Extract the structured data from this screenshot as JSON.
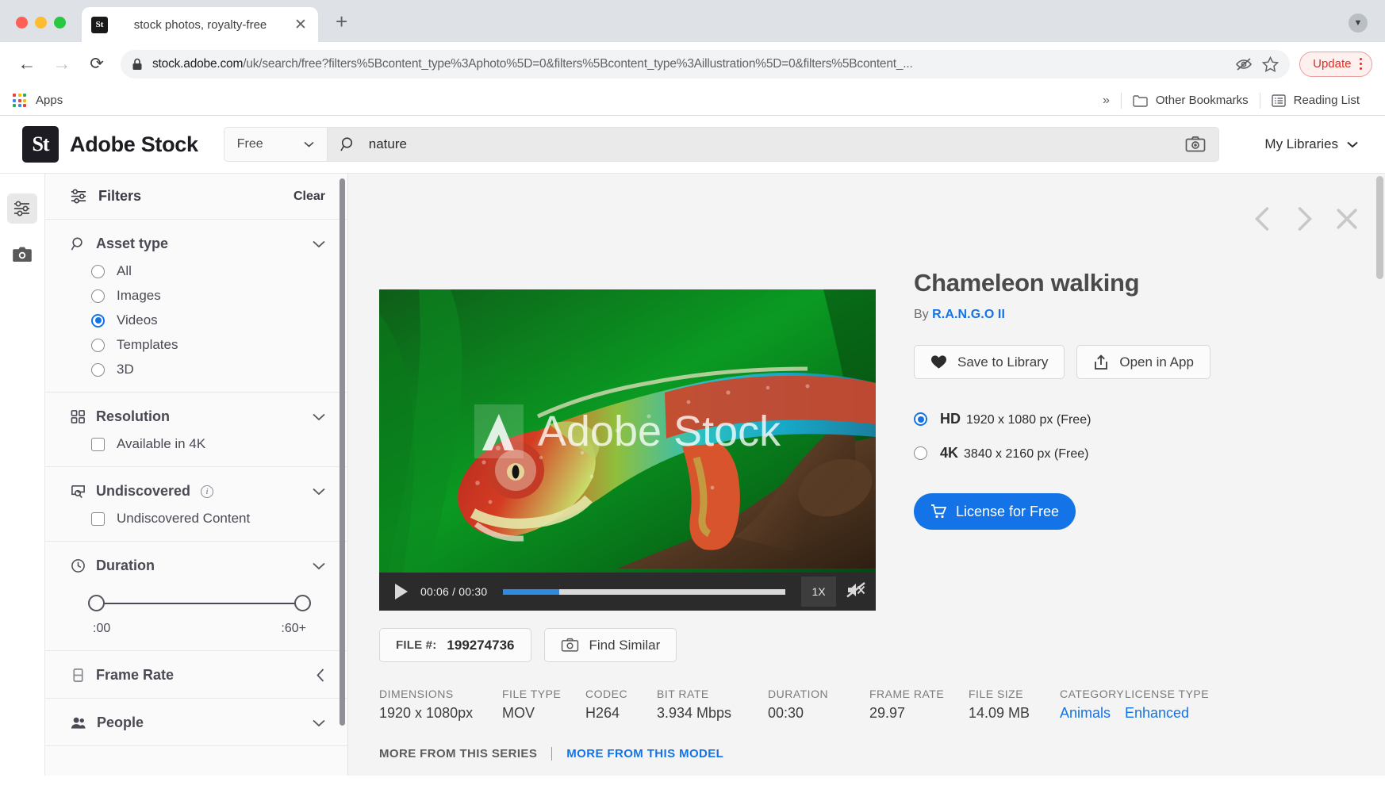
{
  "browser": {
    "tab": {
      "title": "stock photos, royalty-free",
      "favicon": "St",
      "close_icon": "close-icon"
    },
    "new_tab_icon": "plus-icon",
    "nav": {
      "back_icon": "back-arrow-icon",
      "forward_icon": "forward-arrow-icon",
      "reload_icon": "reload-icon"
    },
    "url": {
      "domain": "stock.adobe.com",
      "path": "/uk/search/free?filters%5Bcontent_type%3Aphoto%5D=0&filters%5Bcontent_type%3Aillustration%5D=0&filters%5Bcontent_...",
      "lock_icon": "lock-icon"
    },
    "omnibox_icons": {
      "tracking": "eye-slash-icon",
      "bookmark": "star-icon"
    },
    "update_button": {
      "label": "Update",
      "color": "#d93025"
    },
    "bookmarks": {
      "apps_label": "Apps",
      "overflow": "»",
      "other_bookmarks": "Other Bookmarks",
      "reading_list": "Reading List"
    }
  },
  "site_header": {
    "logo_mark": "St",
    "logo_text": "Adobe Stock",
    "filter_select": {
      "value": "Free",
      "chevron": "chevron-down-icon"
    },
    "search": {
      "value": "nature",
      "placeholder": "Search",
      "search_icon": "search-icon",
      "camera_icon": "camera-icon"
    },
    "my_libraries": {
      "label": "My Libraries",
      "chevron": "chevron-down-icon"
    }
  },
  "rail": {
    "filters_icon": "sliders-icon",
    "camera_icon": "camera-icon"
  },
  "filters": {
    "header": {
      "title": "Filters",
      "clear": "Clear",
      "icon": "sliders-icon"
    },
    "sections": [
      {
        "title": "Asset type",
        "icon": "search-icon",
        "chevron": "chevron-down-icon",
        "type": "radio",
        "options": [
          {
            "label": "All",
            "selected": false
          },
          {
            "label": "Images",
            "selected": false
          },
          {
            "label": "Videos",
            "selected": true
          },
          {
            "label": "Templates",
            "selected": false
          },
          {
            "label": "3D",
            "selected": false
          }
        ]
      },
      {
        "title": "Resolution",
        "icon": "grid-icon",
        "chevron": "chevron-down-icon",
        "type": "checkbox",
        "options": [
          {
            "label": "Available in 4K",
            "selected": false
          }
        ]
      },
      {
        "title": "Undiscovered",
        "icon": "discover-icon",
        "info_icon": "info-icon",
        "chevron": "chevron-down-icon",
        "type": "checkbox",
        "options": [
          {
            "label": "Undiscovered Content",
            "selected": false
          }
        ]
      },
      {
        "title": "Duration",
        "icon": "clock-icon",
        "chevron": "chevron-down-icon",
        "type": "range",
        "min_label": ":00",
        "max_label": ":60+"
      },
      {
        "title": "Frame Rate",
        "icon": "frame-icon",
        "chevron": "chevron-left-icon",
        "type": "collapsed"
      },
      {
        "title": "People",
        "icon": "people-icon",
        "chevron": "chevron-down-icon",
        "type": "collapsed"
      }
    ]
  },
  "detail": {
    "nav": {
      "prev_icon": "chevron-left-icon",
      "next_icon": "chevron-right-icon",
      "close_icon": "close-icon"
    },
    "title": "Chameleon walking",
    "by_prefix": "By",
    "author": "R.A.N.G.O II",
    "buttons": [
      {
        "label": "Save to Library",
        "icon": "heart-icon"
      },
      {
        "label": "Open in App",
        "icon": "share-up-icon"
      }
    ],
    "resolutions": [
      {
        "name": "HD",
        "dims": "1920 x 1080 px (Free)",
        "selected": true
      },
      {
        "name": "4K",
        "dims": "3840 x 2160 px (Free)",
        "selected": false
      }
    ],
    "license_button": {
      "label": "License for Free",
      "icon": "cart-icon",
      "color": "#1473e6"
    },
    "player": {
      "play_icon": "play-icon",
      "time": "00:06 / 00:30",
      "progress_percent": 20,
      "speed": "1X",
      "mute_icon": "volume-mute-icon"
    },
    "watermark": "Adobe Stock",
    "file_button": {
      "label": "FILE #:",
      "value": "199274736"
    },
    "find_similar": {
      "label": "Find Similar",
      "icon": "camera-icon"
    },
    "metadata": [
      {
        "label": "DIMENSIONS",
        "value": "1920 x 1080px",
        "link": false
      },
      {
        "label": "FILE TYPE",
        "value": "MOV",
        "link": false
      },
      {
        "label": "CODEC",
        "value": "H264",
        "link": false
      },
      {
        "label": "BIT RATE",
        "value": "3.934 Mbps",
        "link": false
      },
      {
        "label": "DURATION",
        "value": "00:30",
        "link": false
      },
      {
        "label": "FRAME RATE",
        "value": "29.97",
        "link": false
      },
      {
        "label": "FILE SIZE",
        "value": "14.09 MB",
        "link": false
      },
      {
        "label": "CATEGORY",
        "value": "Animals",
        "link": true
      },
      {
        "label": "LICENSE TYPE",
        "value": "Enhanced",
        "link": true
      }
    ],
    "more_links": [
      {
        "label": "MORE FROM THIS SERIES",
        "highlight": false
      },
      {
        "label": "MORE FROM THIS MODEL",
        "highlight": true
      }
    ]
  }
}
